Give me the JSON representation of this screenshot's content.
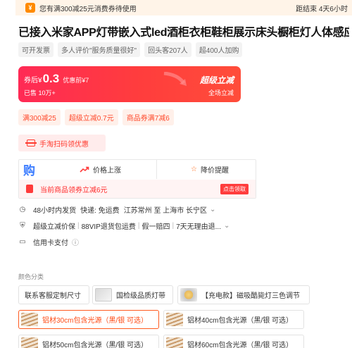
{
  "banner": {
    "icon": "coupon-bag-icon",
    "text": "您有满300减25元消费券待使用",
    "countdown": "距结束 4天6小时"
  },
  "product": {
    "title": "已接入米家APP灯带嵌入式led酒柜衣柜鞋柜展示床头橱柜灯人体感应"
  },
  "tags": [
    "可开发票",
    "多人评价\"服务质量很好\"",
    "回头客207人",
    "超400人加购"
  ],
  "price_card": {
    "prefix": "券后¥",
    "price": "0.3",
    "original": "优惠前¥7",
    "sold": "已售 10万+",
    "promo_title": "超级立减",
    "promo_sub": "全场立减",
    "accent_color": "#ff3344"
  },
  "coupons": [
    "满300减25",
    "超级立减0.7元",
    "商品券满7减6"
  ],
  "scan_button": {
    "label": "手淘扫码领优惠",
    "icon": "scan-icon"
  },
  "price_tools": {
    "logo": "购",
    "trend": {
      "label": "价格上涨",
      "icon": "trend-up-icon"
    },
    "alert": {
      "label": "降价提醒",
      "icon": "star-icon"
    },
    "coupon_text": "当前商品领券立减6元",
    "claim_label": "点击领取"
  },
  "shipping": {
    "time": "48小时内发货",
    "delivery": "快递: 免运费",
    "route": "江苏常州 至 上海市 长宁区",
    "chevron": "⌄"
  },
  "guarantee": {
    "items": [
      "超级立减价保",
      "88VIP退货包运费",
      "假一赔四",
      "7天无理由退..."
    ],
    "chevron": "⌄"
  },
  "payment": {
    "label": "信用卡支付",
    "info": "ⓘ"
  },
  "sku_section": {
    "label": "颜色分类",
    "options": [
      {
        "label": "联系客服定制尺寸",
        "thumb": "none",
        "selected": false
      },
      {
        "label": "国检级品质灯带",
        "thumb": "plain",
        "selected": false
      },
      {
        "label": "【充电款】磁吸酷毙灯三色调节",
        "thumb": "bulb",
        "selected": false
      },
      {
        "label": "铝材30cm包含光源（黑/银 可选）",
        "thumb": "strip",
        "selected": true
      },
      {
        "label": "铝材40cm包含光源（黑/银 可选）",
        "thumb": "strip",
        "selected": false
      },
      {
        "label": "铝材50cm包含光源（黑/银 可选）",
        "thumb": "strip",
        "selected": false
      },
      {
        "label": "铝材60cm包含光源（黑/银 可选）",
        "thumb": "strip",
        "selected": false
      }
    ]
  }
}
